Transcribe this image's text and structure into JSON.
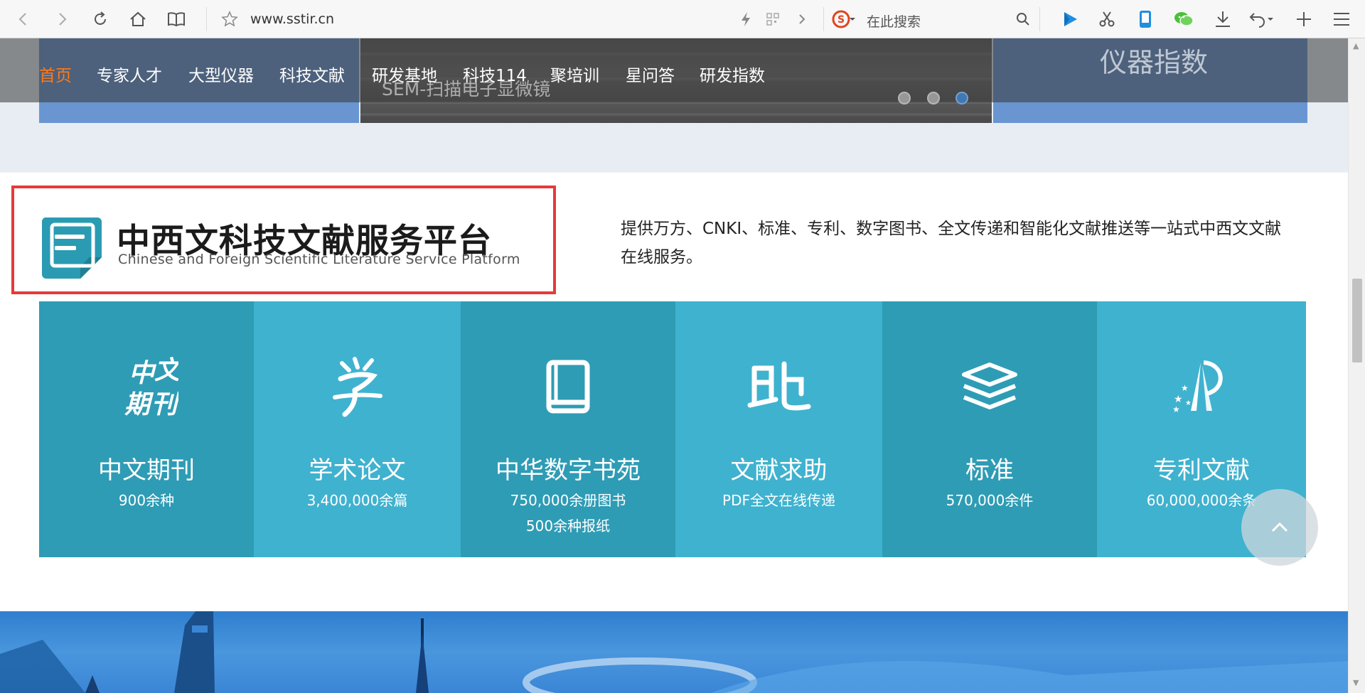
{
  "browser": {
    "url": "www.sstir.cn",
    "search_placeholder": "在此搜索"
  },
  "nav": {
    "items": [
      "首页",
      "专家人才",
      "大型仪器",
      "科技文献",
      "研发基地",
      "科技114",
      "聚培训",
      "星问答",
      "研发指数"
    ],
    "active_index": 0
  },
  "banner": {
    "slide_caption": "SEM-扫描电子显微镜",
    "right_panel_label": "仪器指数",
    "dots_count": 3,
    "active_dot": 2
  },
  "platform": {
    "title": "中西文科技文献服务平台",
    "subtitle": "Chinese and Foreign Scientific Literature Service Platform",
    "description": "提供万方、CNKI、标准、专利、数字图书、全文传递和智能化文献推送等一站式中西文文献在线服务。"
  },
  "tiles": [
    {
      "title": "中文期刊",
      "sub1": "900余种",
      "sub2": "",
      "icon": "chinese-journal-icon",
      "color": "#2e9cb5"
    },
    {
      "title": "学术论文",
      "sub1": "3,400,000余篇",
      "sub2": "",
      "icon": "academic-paper-icon",
      "color": "#3fb2cf"
    },
    {
      "title": "中华数字书苑",
      "sub1": "750,000余册图书",
      "sub2": "500余种报纸",
      "icon": "book-icon",
      "color": "#2e9cb5"
    },
    {
      "title": "文献求助",
      "sub1": "PDF全文在线传递",
      "sub2": "",
      "icon": "help-icon",
      "color": "#3fb2cf"
    },
    {
      "title": "标准",
      "sub1": "570,000余件",
      "sub2": "",
      "icon": "layers-icon",
      "color": "#2e9cb5"
    },
    {
      "title": "专利文献",
      "sub1": "60,000,000余条",
      "sub2": "",
      "icon": "patent-icon",
      "color": "#3fb2cf"
    }
  ],
  "colors": {
    "accent_nav": "#ff7a1a",
    "highlight_border": "#e53a3a",
    "logo_teal": "#2a9bb3"
  }
}
